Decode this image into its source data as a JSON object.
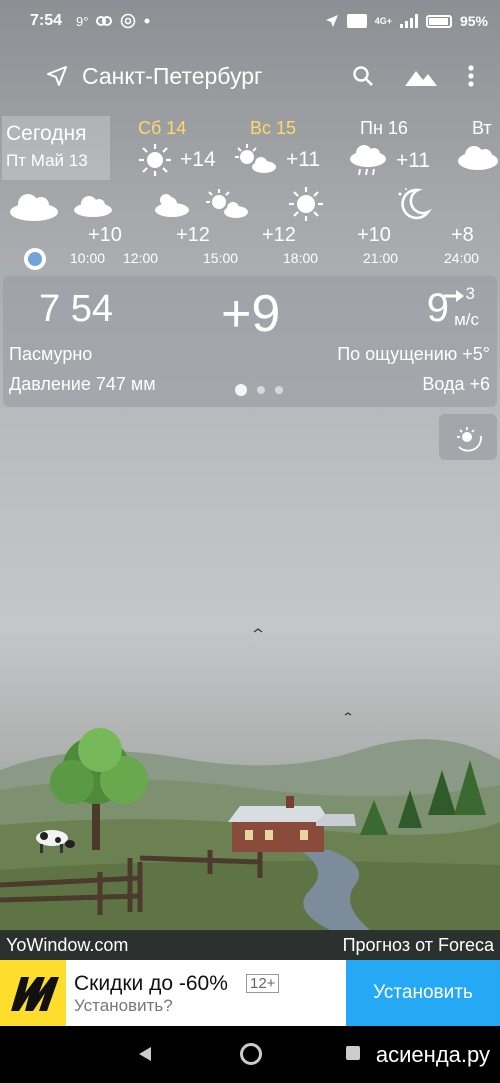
{
  "status_bar": {
    "time": "7:54",
    "temp_notification": "9°",
    "icons_left": [
      "link-icon",
      "at-icon",
      "dot-icon"
    ],
    "icons_right": [
      "location-arrow-icon",
      "volte-icon",
      "4g-icon",
      "signal-icon",
      "battery-icon"
    ],
    "network": "4G+",
    "volte": "Vo LTE",
    "battery": "95%"
  },
  "header": {
    "city": "Санкт-Петербург"
  },
  "today": {
    "label": "Сегодня",
    "date": "Пт Май 13"
  },
  "days": [
    {
      "name": "Сб 14",
      "temp": "+14",
      "icon": "sun-icon",
      "weekend": true
    },
    {
      "name": "Вс 15",
      "temp": "+11",
      "icon": "partly-cloudy-icon",
      "weekend": true
    },
    {
      "name": "Пн 16",
      "temp": "+11",
      "icon": "rain-cloud-icon",
      "weekend": false
    },
    {
      "name": "Вт",
      "temp": "",
      "icon": "cloud-icon",
      "weekend": false
    }
  ],
  "hourly": [
    {
      "time": "10:00",
      "temp": "+10"
    },
    {
      "time": "12:00",
      "temp": ""
    },
    {
      "time": "15:00",
      "temp": "+12"
    },
    {
      "time": "18:00",
      "temp": "+12"
    },
    {
      "time": "21:00",
      "temp": "+10"
    },
    {
      "time": "24:00",
      "temp": "+8"
    }
  ],
  "current": {
    "time": "7 54",
    "temp": "+9",
    "wind_value": "9",
    "wind_speed_extra": "3",
    "wind_unit": "м/с",
    "condition": "Пасмурно",
    "feels_like": "По ощущению +5°",
    "pressure": "Давление 747 мм",
    "water": "Вода +6",
    "pager_pages": 3,
    "pager_active": 1
  },
  "footer": {
    "left": "YoWindow.com",
    "right": "Прогноз от Foreca"
  },
  "ad": {
    "title": "Скидки до -60%",
    "age": "12+",
    "subtitle": "Установить?",
    "button": "Установить",
    "logo_color": "#ffdd2d",
    "button_color": "#26a9f5"
  },
  "navbar": {
    "watermark": "асиенда.ру"
  }
}
